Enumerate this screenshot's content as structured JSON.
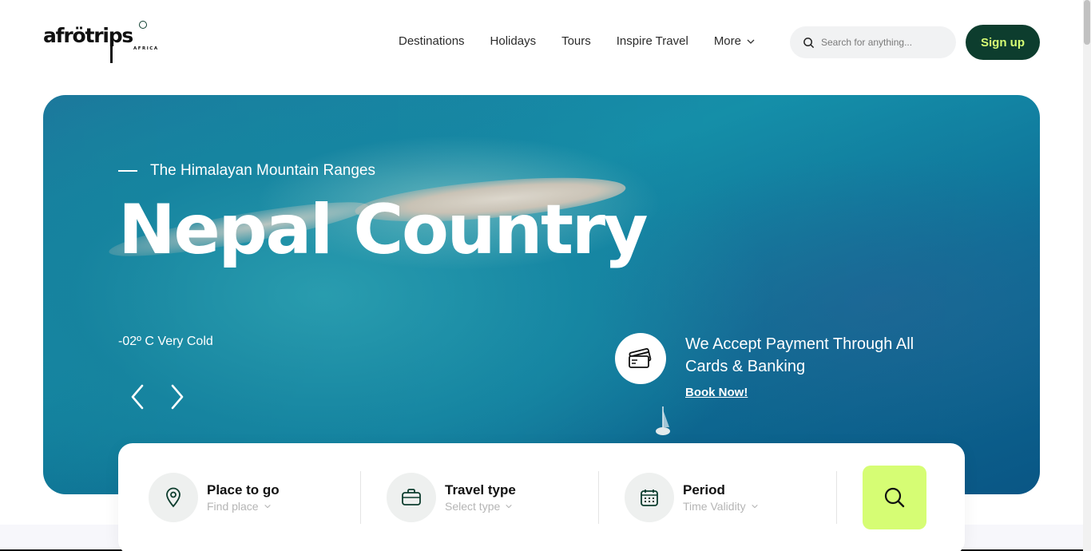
{
  "header": {
    "logo_text": "afrötrips",
    "logo_sub": "AFRICA",
    "nav": [
      {
        "label": "Destinations"
      },
      {
        "label": "Holidays"
      },
      {
        "label": "Tours"
      },
      {
        "label": "Inspire Travel"
      },
      {
        "label": "More",
        "icon": "chevron-down-icon"
      }
    ],
    "search_placeholder": "Search for anything...",
    "signup_label": "Sign up"
  },
  "hero": {
    "subtitle": "The Himalayan Mountain Ranges",
    "title": "Nepal Country",
    "temperature": "-02º C Very Cold",
    "payment_text": "We Accept Payment Through All Cards & Banking",
    "book_label": "Book Now!"
  },
  "search_panel": {
    "fields": [
      {
        "label": "Place to go",
        "value": "Find place",
        "icon": "map-pin-icon"
      },
      {
        "label": "Travel type",
        "value": "Select type",
        "icon": "briefcase-icon"
      },
      {
        "label": "Period",
        "value": "Time Validity",
        "icon": "calendar-icon"
      }
    ],
    "submit_icon": "search-icon"
  },
  "colors": {
    "brand_dark": "#0d3d2e",
    "accent_lime": "#d6fd74"
  }
}
